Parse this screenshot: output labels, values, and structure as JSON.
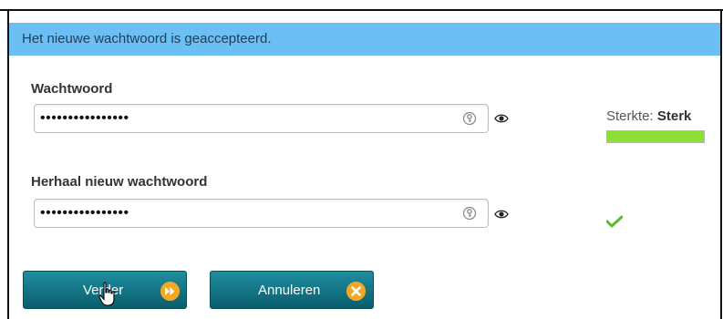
{
  "banner": {
    "message": "Het nieuwe wachtwoord is geaccepteerd."
  },
  "password": {
    "label": "Wachtwoord",
    "value": "••••••••••••••••",
    "strength_prefix": "Sterkte: ",
    "strength_value": "Sterk",
    "strength_level": 1.0,
    "strength_color": "#8de033"
  },
  "repeat": {
    "label": "Herhaal nieuw wachtwoord",
    "value": "••••••••••••••••"
  },
  "buttons": {
    "next_label": "Verder",
    "cancel_label": "Annuleren"
  },
  "icons": {
    "key": "key-icon",
    "eye": "eye-icon",
    "check": "check-icon",
    "next": "fast-forward-icon",
    "cancel": "close-icon",
    "cursor": "hand-pointer-icon"
  },
  "colors": {
    "banner_bg": "#6cbff3",
    "button_bg": "#0f6f80",
    "button_icon": "#f5a623"
  }
}
